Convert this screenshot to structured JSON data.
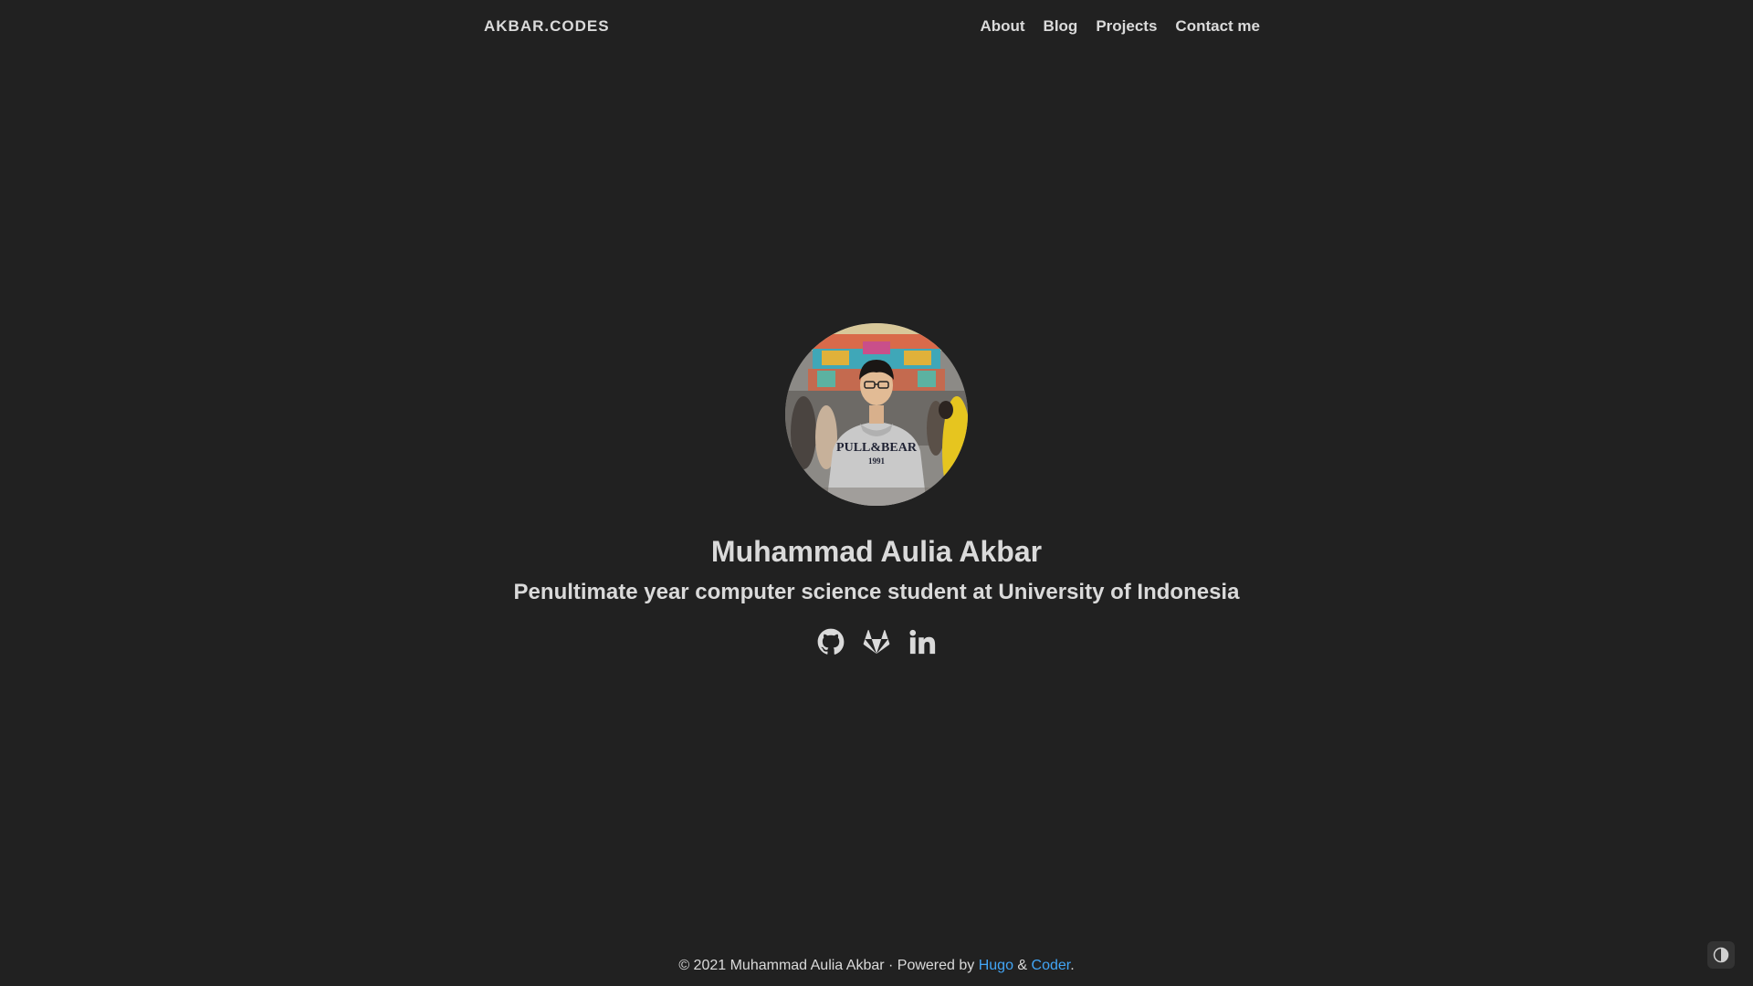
{
  "navbar": {
    "brand": "AKBAR.CODES",
    "links": [
      {
        "label": "About"
      },
      {
        "label": "Blog"
      },
      {
        "label": "Projects"
      },
      {
        "label": "Contact me"
      }
    ]
  },
  "hero": {
    "avatar_icon": "profile-photo",
    "name": "Muhammad Aulia Akbar",
    "tagline": "Penultimate year computer science student at University of Indonesia",
    "socials": [
      {
        "icon": "github-icon"
      },
      {
        "icon": "gitlab-icon"
      },
      {
        "icon": "linkedin-icon"
      }
    ]
  },
  "footer": {
    "copyright": "© 2021 Muhammad Aulia Akbar · Powered by ",
    "hugo_label": "Hugo",
    "amp": " & ",
    "coder_label": "Coder",
    "end": "."
  },
  "theme": {
    "background": "#212121",
    "text": "#dadada",
    "link": "#42a5f5",
    "toggle_icon": "contrast-icon"
  }
}
